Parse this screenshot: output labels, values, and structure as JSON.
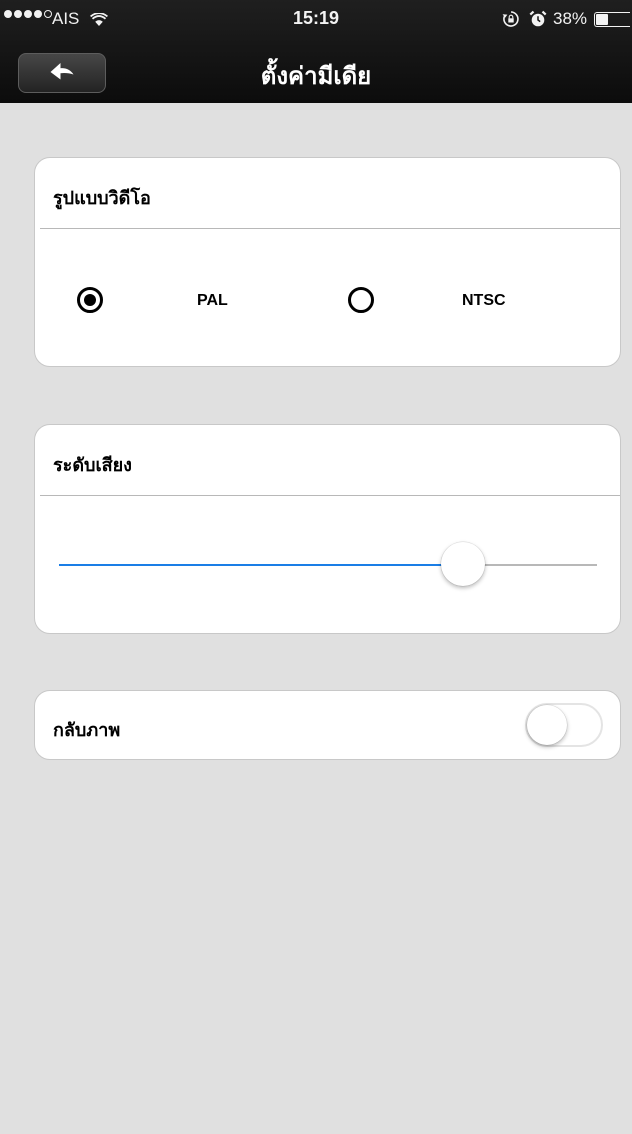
{
  "status_bar": {
    "carrier": "AIS",
    "time": "15:19",
    "battery_percent": "38%",
    "battery_level": 0.38,
    "signal_bars_filled": 4,
    "signal_bars_total": 5,
    "icons": [
      "signal-dots-icon",
      "wifi-icon",
      "rotation-lock-icon",
      "alarm-icon",
      "battery-icon"
    ]
  },
  "nav": {
    "title": "ตั้งค่ามีเดีย",
    "back_icon": "back-arrow-icon"
  },
  "video_format": {
    "title": "รูปแบบวิดีโอ",
    "options": [
      {
        "label": "PAL",
        "selected": true
      },
      {
        "label": "NTSC",
        "selected": false
      }
    ]
  },
  "volume": {
    "title": "ระดับเสียง",
    "level": 0.75
  },
  "flip": {
    "title": "กลับภาพ",
    "enabled": false
  },
  "colors": {
    "nav_background": "#141414",
    "page_background": "#e0e0e0",
    "card_background": "#ffffff",
    "slider_fill": "#1a7ee6",
    "slider_track": "#b8b8b8"
  }
}
